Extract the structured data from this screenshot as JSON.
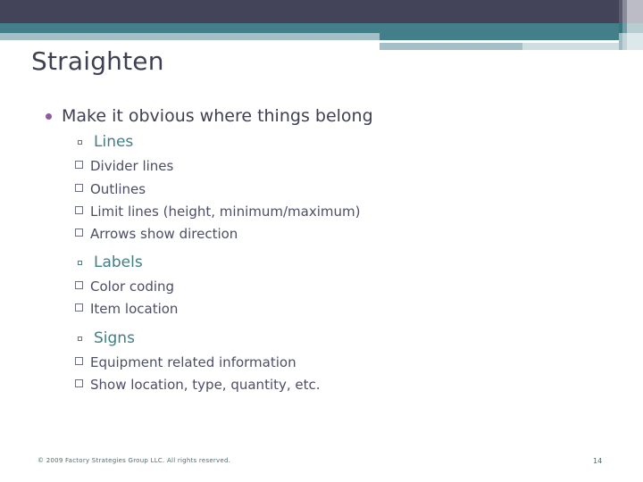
{
  "slide": {
    "title": "Straighten",
    "page_number": "14",
    "copyright": "© 2009 Factory Strategies Group LLC. All rights reserved.",
    "colors": {
      "header_dark": "#434459",
      "header_teal": "#427f88",
      "header_pale": "#a4c0c6",
      "title_text": "#3f4052",
      "level1_bullet": "#8d5b9e",
      "level2_text": "#3f7f85",
      "level3_text": "#4c4e66",
      "footer_text": "#4e6b6e"
    },
    "bullets": {
      "level1": {
        "text": "Make it obvious where things belong",
        "groups": [
          {
            "heading": "Lines",
            "items": [
              "Divider lines",
              "Outlines",
              "Limit lines (height, minimum/maximum)",
              "Arrows show direction"
            ]
          },
          {
            "heading": "Labels",
            "items": [
              "Color coding",
              "Item location"
            ]
          },
          {
            "heading": "Signs",
            "items": [
              "Equipment related information",
              "Show location, type, quantity, etc."
            ]
          }
        ]
      }
    }
  }
}
